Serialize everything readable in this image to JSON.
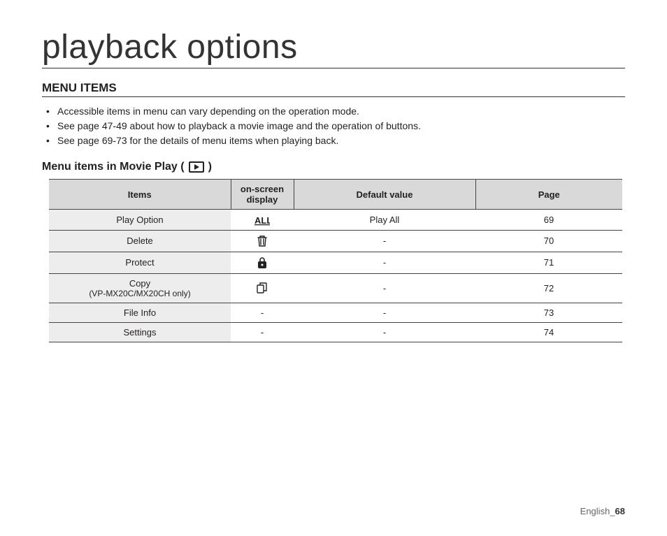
{
  "title": "playback options",
  "section_heading": "MENU ITEMS",
  "bullets": [
    "Accessible items in menu can vary depending on the operation mode.",
    "See page 47-49 about how to playback a movie image and the operation of buttons.",
    "See page 69-73 for the details of menu items when playing back."
  ],
  "subheading_prefix": "Menu items in Movie Play (",
  "subheading_suffix": ")",
  "table": {
    "headers": {
      "items": "Items",
      "osd": "on-screen display",
      "default": "Default value",
      "page": "Page"
    },
    "rows": [
      {
        "item": "Play Option",
        "sub": "",
        "icon": "play-all",
        "default": "Play All",
        "page": "69"
      },
      {
        "item": "Delete",
        "sub": "",
        "icon": "trash",
        "default": "-",
        "page": "70"
      },
      {
        "item": "Protect",
        "sub": "",
        "icon": "lock",
        "default": "-",
        "page": "71"
      },
      {
        "item": "Copy",
        "sub": "(VP-MX20C/MX20CH only)",
        "icon": "copy",
        "default": "-",
        "page": "72"
      },
      {
        "item": "File Info",
        "sub": "",
        "icon": "-",
        "default": "-",
        "page": "73"
      },
      {
        "item": "Settings",
        "sub": "",
        "icon": "-",
        "default": "-",
        "page": "74"
      }
    ]
  },
  "footer": {
    "lang": "English",
    "sep": "_",
    "page": "68"
  }
}
